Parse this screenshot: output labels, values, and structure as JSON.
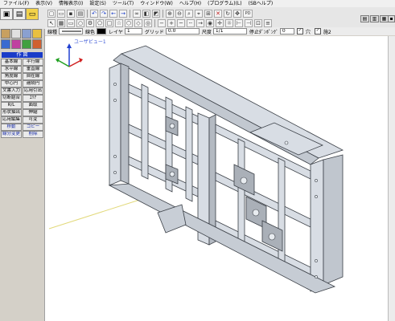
{
  "menu": [
    "ファイル(F)",
    "表示(V)",
    "情報表示(I)",
    "設定(S)",
    "ツール(T)",
    "ウィンドウ(W)",
    "ヘルプ(H)",
    "(プログラム)(L)",
    "(SBヘルプ)"
  ],
  "toolbar": {
    "pd_label": "PD"
  },
  "props": {
    "linetype_label": "線種",
    "color_label": "線色",
    "layer_label": "レイヤ",
    "layer_value": "1",
    "grid_label": "グリッド",
    "grid_value": "0.0",
    "scale_label": "尺度",
    "scale_value": "1/1",
    "snap_label": "停止ﾀﾞﾝﾎﾟﾝｸﾞ",
    "snap_value": "0",
    "check1_label": "穴",
    "check2_label": "施2"
  },
  "panel": {
    "title": "作 図",
    "buttons": [
      "基本線",
      "平行線",
      "水平線",
      "垂直線",
      "角度線",
      "自在線",
      "中心円",
      "連続円",
      "文書入力",
      "応用引出",
      "切断結合",
      "ｴﾘｱ",
      "R/L",
      "面取",
      "形状抽出",
      "伸縮",
      "応用編集",
      "可変",
      "移動",
      "コピー",
      "線分変更",
      "削除"
    ]
  },
  "viewport": {
    "title": "ユーザビュー1"
  },
  "colors": {
    "panel_title_bg": "#1a3cc8",
    "axis_x": "#d02020",
    "axis_y": "#20a020",
    "axis_z": "#2040d0",
    "part_fill": "#d8dde4",
    "edge": "#3a3f46"
  }
}
